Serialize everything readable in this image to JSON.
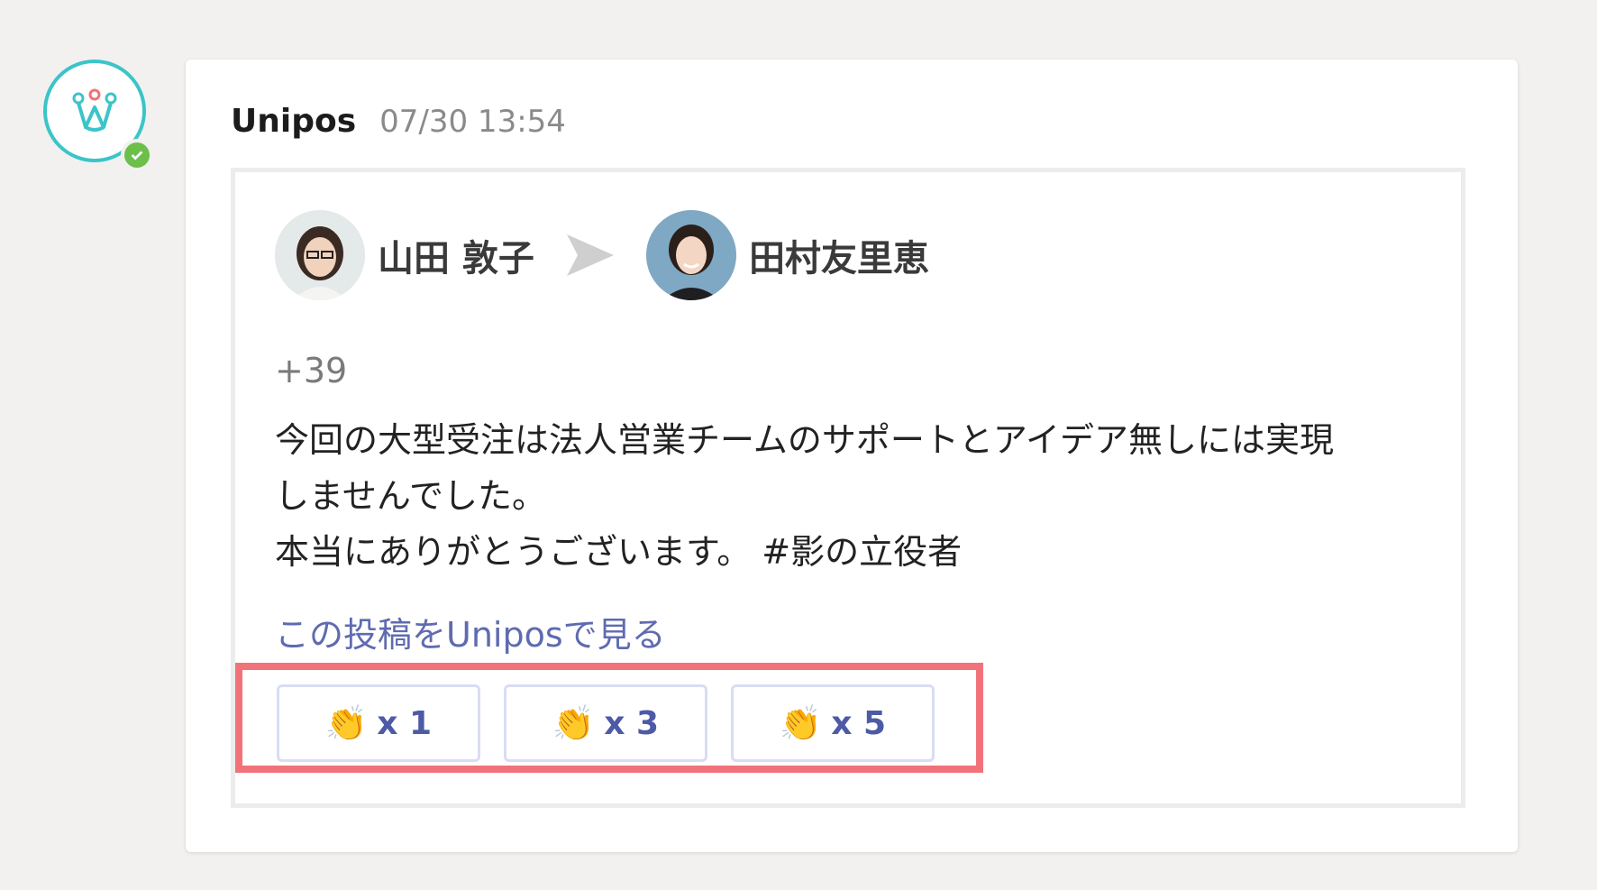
{
  "message": {
    "sender": "Unipos",
    "timestamp": "07/30 13:54"
  },
  "card": {
    "from_name": "山田 敦子",
    "to_name": "田村友里恵",
    "points": "+39",
    "body_lines": [
      "今回の大型受注は法人営業チームのサポートとアイデア無しには実現",
      "しませんでした。",
      "本当にありがとうございます。 #影の立役者"
    ],
    "view_link": "この投稿をUniposで見る"
  },
  "clap_buttons": [
    {
      "icon": "👏",
      "label": "x 1"
    },
    {
      "icon": "👏",
      "label": "x 3"
    },
    {
      "icon": "👏",
      "label": "x 5"
    }
  ],
  "colors": {
    "brand_teal": "#3bc4c9",
    "online_green": "#6cc04a",
    "link_blue": "#5f6bb0",
    "highlight_red": "#f2727a"
  }
}
